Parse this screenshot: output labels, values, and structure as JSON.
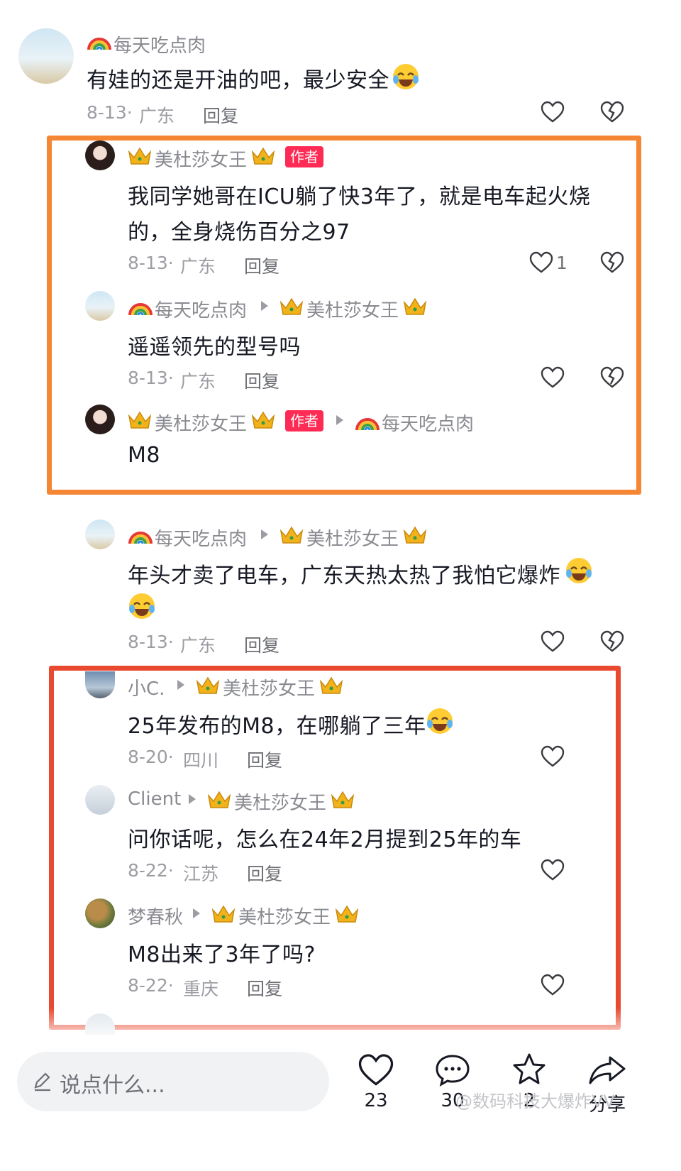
{
  "colors": {
    "author_tag": "#fe2c55",
    "highlight_orange": "#f58634",
    "highlight_red": "#e8492f"
  },
  "comments": [
    {
      "user": "每天吃点肉",
      "text": "有娃的还是开油的吧，最少安全",
      "date": "8-13·",
      "region": "广东",
      "reply": "回复"
    },
    {
      "user": "美杜莎女王",
      "tag": "作者",
      "text_line1": "我同学她哥在ICU躺了快3年了，就是电车起火烧",
      "text_line2": "的，全身烧伤百分之97",
      "date": "8-13·",
      "region": "广东",
      "reply": "回复",
      "likes": "1"
    },
    {
      "user": "每天吃点肉",
      "to": "美杜莎女王",
      "text": "遥遥领先的型号吗",
      "date": "8-13·",
      "region": "广东",
      "reply": "回复"
    },
    {
      "user": "美杜莎女王",
      "tag": "作者",
      "to": "每天吃点肉",
      "text": "M8"
    },
    {
      "user": "每天吃点肉",
      "to": "美杜莎女王",
      "text": "年头才卖了电车，广东天热太热了我怕它爆炸",
      "date": "8-13·",
      "region": "广东",
      "reply": "回复"
    },
    {
      "user": "小C.",
      "to": "美杜莎女王",
      "text": "25年发布的M8，在哪躺了三年",
      "date": "8-20·",
      "region": "四川",
      "reply": "回复"
    },
    {
      "user": "Client",
      "to": "美杜莎女王",
      "text": "问你话呢，怎么在24年2月提到25年的车",
      "date": "8-22·",
      "region": "江苏",
      "reply": "回复"
    },
    {
      "user": "梦春秋",
      "to": "美杜莎女王",
      "text": "M8出来了3年了吗?",
      "date": "8-22·",
      "region": "重庆",
      "reply": "回复"
    }
  ],
  "bottom_bar": {
    "input_placeholder": "说点什么...",
    "like_count": "23",
    "comment_count": "30",
    "star_count": "2",
    "share_label": "分享",
    "watermark": "@数码科技大爆炸VV"
  },
  "icons": [
    "heart-icon",
    "broken-heart-icon",
    "rainbow-emoji",
    "crown-emoji",
    "laugh-cry-emoji",
    "pencil-icon",
    "comment-bubble-icon",
    "star-icon",
    "share-arrow-icon"
  ]
}
